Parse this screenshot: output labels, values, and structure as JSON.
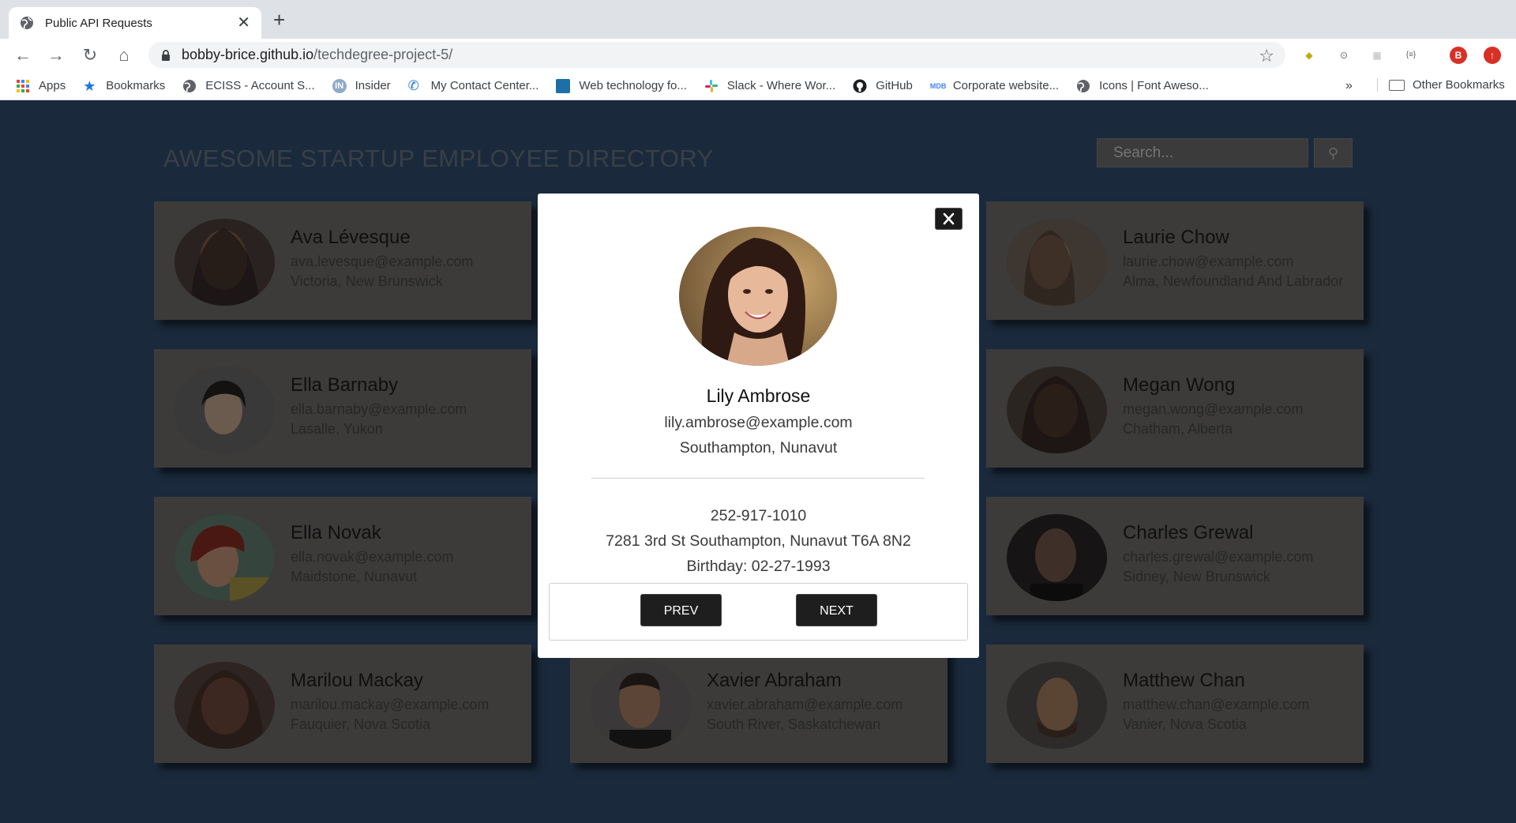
{
  "browser": {
    "tab_title": "Public API Requests",
    "url_host": "bobby-brice.github.io",
    "url_path": "/techdegree-project-5/",
    "profile_initial": "B",
    "bookmarks": [
      {
        "label": "Apps",
        "icon": "apps-grid-icon"
      },
      {
        "label": "Bookmarks",
        "icon": "star-icon"
      },
      {
        "label": "ECISS - Account S...",
        "icon": "globe-icon"
      },
      {
        "label": "Insider",
        "icon": "insider-icon"
      },
      {
        "label": "My Contact Center...",
        "icon": "phone-icon"
      },
      {
        "label": "Web technology fo...",
        "icon": "mdn-icon"
      },
      {
        "label": "Slack - Where Wor...",
        "icon": "slack-icon"
      },
      {
        "label": "GitHub",
        "icon": "github-icon"
      },
      {
        "label": "Corporate website...",
        "icon": "mdb-icon"
      },
      {
        "label": "Icons | Font Aweso...",
        "icon": "globe-icon"
      }
    ],
    "more_bookmarks": "»",
    "other_bookmarks": "Other Bookmarks"
  },
  "page": {
    "title": "AWESOME STARTUP EMPLOYEE DIRECTORY",
    "search_placeholder": "Search...",
    "search_button_icon": "magnifier-icon"
  },
  "employees": [
    {
      "name": "Ava Lévesque",
      "email": "ava.levesque@example.com",
      "city": "Victoria, New Brunswick"
    },
    {
      "name": "Laurie Chow",
      "email": "laurie.chow@example.com",
      "city": "Alma, Newfoundland And Labrador"
    },
    {
      "name": "Ella Barnaby",
      "email": "ella.barnaby@example.com",
      "city": "Lasalle, Yukon"
    },
    {
      "name": "Megan Wong",
      "email": "megan.wong@example.com",
      "city": "Chatham, Alberta"
    },
    {
      "name": "Ella Novak",
      "email": "ella.novak@example.com",
      "city": "Maidstone, Nunavut"
    },
    {
      "name": "Charles Grewal",
      "email": "charles.grewal@example.com",
      "city": "Sidney, New Brunswick"
    },
    {
      "name": "Marilou Mackay",
      "email": "marilou.mackay@example.com",
      "city": "Fauquier, Nova Scotia"
    },
    {
      "name": "Xavier Abraham",
      "email": "xavier.abraham@example.com",
      "city": "South River, Saskatchewan"
    },
    {
      "name": "Matthew Chan",
      "email": "matthew.chan@example.com",
      "city": "Vanier, Nova Scotia"
    }
  ],
  "modal": {
    "name": "Lily Ambrose",
    "email": "lily.ambrose@example.com",
    "city": "Southampton, Nunavut",
    "phone": "252-917-1010",
    "address": "7281 3rd St Southampton, Nunavut T6A 8N2",
    "birthday": "Birthday: 02-27-1993",
    "prev_label": "PREV",
    "next_label": "NEXT"
  },
  "colors": {
    "page_background": "#1a2a3c",
    "card_background": "#3c3b3a",
    "button_background": "#1e1e1e"
  }
}
